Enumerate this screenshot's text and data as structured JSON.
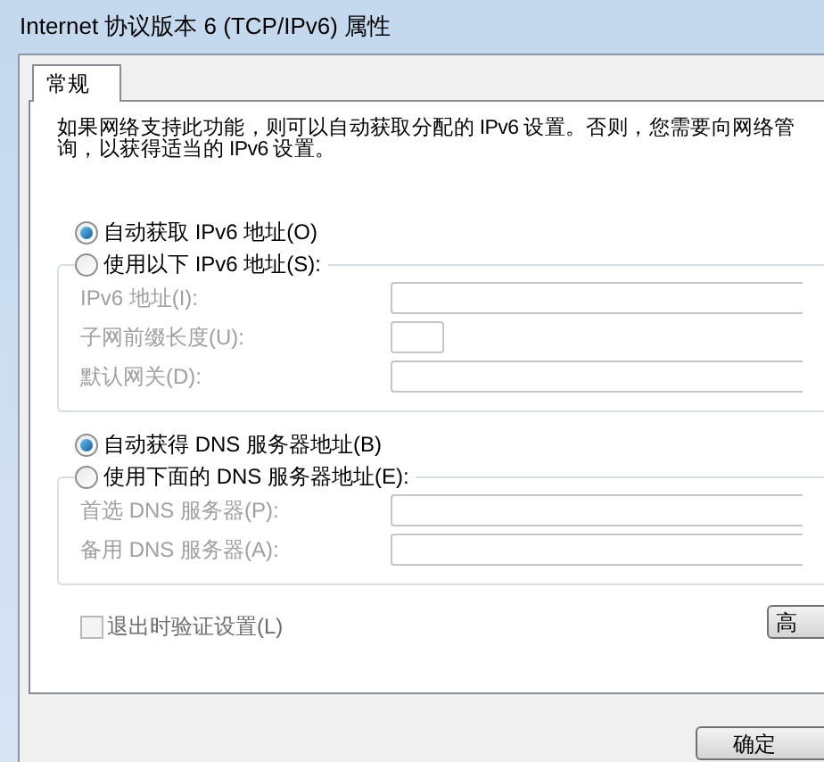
{
  "window": {
    "title": "Internet 协议版本 6 (TCP/IPv6) 属性"
  },
  "tabs": [
    {
      "label": "常规",
      "selected": true
    }
  ],
  "description": [
    "如果网络支持此功能，则可以自动获取分配的 IPv6 设置。否则，您需要向网络管",
    "询，以获得适当的 IPv6 设置。"
  ],
  "address_section": {
    "auto_option": {
      "label": "自动获取 IPv6 地址(O)",
      "selected": true
    },
    "manual_option": {
      "label": "使用以下 IPv6 地址(S):",
      "selected": false
    },
    "fields": [
      {
        "label": "IPv6 地址(I):",
        "kind": "wide",
        "disabled": true
      },
      {
        "label": "子网前缀长度(U):",
        "kind": "short",
        "disabled": true
      },
      {
        "label": "默认网关(D):",
        "kind": "wide",
        "disabled": true
      }
    ]
  },
  "dns_section": {
    "auto_option": {
      "label": "自动获得 DNS 服务器地址(B)",
      "selected": true
    },
    "manual_option": {
      "label": "使用下面的 DNS 服务器地址(E):",
      "selected": false
    },
    "fields": [
      {
        "label": "首选 DNS 服务器(P):",
        "kind": "wide",
        "disabled": true
      },
      {
        "label": "备用 DNS 服务器(A):",
        "kind": "wide",
        "disabled": true
      }
    ]
  },
  "validate_checkbox": {
    "label": "退出时验证设置(L)",
    "checked": false,
    "disabled": true
  },
  "advanced_button": {
    "label": "高"
  },
  "ok_button": {
    "label": "确定"
  }
}
